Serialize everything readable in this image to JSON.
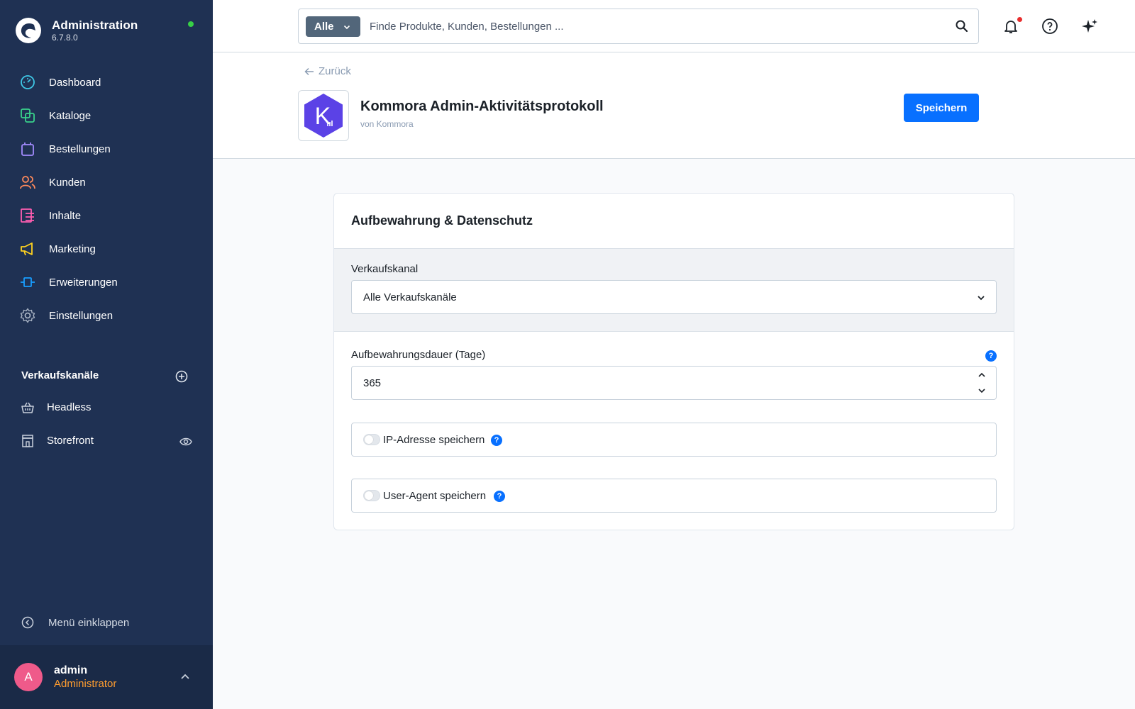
{
  "sidebar": {
    "title": "Administration",
    "version": "6.7.8.0",
    "items": [
      {
        "label": "Dashboard",
        "icon": "dashboard-icon",
        "color": "#3fc8e6"
      },
      {
        "label": "Kataloge",
        "icon": "catalog-icon",
        "color": "#39d28b"
      },
      {
        "label": "Bestellungen",
        "icon": "bag-icon",
        "color": "#a38cff"
      },
      {
        "label": "Kunden",
        "icon": "users-icon",
        "color": "#ff8a5b"
      },
      {
        "label": "Inhalte",
        "icon": "content-icon",
        "color": "#ff5db1"
      },
      {
        "label": "Marketing",
        "icon": "megaphone-icon",
        "color": "#ffd21f"
      },
      {
        "label": "Erweiterungen",
        "icon": "plug-icon",
        "color": "#189eff"
      },
      {
        "label": "Einstellungen",
        "icon": "gear-icon",
        "color": "#a6b1c2"
      }
    ],
    "sales_channels_title": "Verkaufskanäle",
    "channels": [
      {
        "label": "Headless",
        "icon": "basket-icon"
      },
      {
        "label": "Storefront",
        "icon": "storefront-icon"
      }
    ],
    "collapse_label": "Menü einklappen",
    "user": {
      "initial": "A",
      "name": "admin",
      "role": "Administrator"
    }
  },
  "search": {
    "type_label": "Alle",
    "placeholder": "Finde Produkte, Kunden, Bestellungen ..."
  },
  "header": {
    "back_label": "Zurück",
    "app_name": "Kommora Admin-Aktivitätsprotokoll",
    "vendor": "von Kommora",
    "save_label": "Speichern",
    "icon_letter": "K"
  },
  "card": {
    "title": "Aufbewahrung & Datenschutz",
    "sales_channel_label": "Verkaufskanal",
    "sales_channel_value": "Alle Verkaufskanäle",
    "retention_label": "Aufbewahrungsdauer (Tage)",
    "retention_value": "365",
    "toggles": [
      {
        "label": "IP-Adresse speichern",
        "enabled": false
      },
      {
        "label": "User-Agent speichern",
        "enabled": false
      }
    ],
    "help_glyph": "?"
  },
  "colors": {
    "accent": "#0870ff",
    "sidebar": "#1f3153",
    "avatar": "#ef5a8a",
    "role": "#ff9d2f"
  }
}
